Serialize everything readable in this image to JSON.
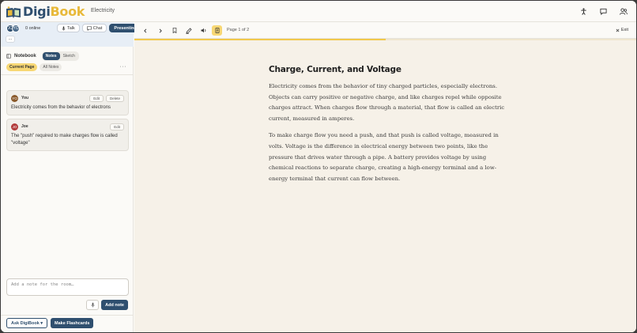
{
  "app": {
    "brand_part1": "Digi",
    "brand_part2": "Book",
    "page_topic": "Electricity"
  },
  "room": {
    "online_label": "0 online",
    "avatars": [
      "JO",
      "YO"
    ],
    "modes": [
      {
        "label": "Talk",
        "icon": "microphone-icon",
        "active": false
      },
      {
        "label": "Chat",
        "icon": "chat-icon",
        "active": false
      },
      {
        "label": "Presenting",
        "icon": "",
        "active": true
      }
    ],
    "more_label": "..."
  },
  "notebook": {
    "title": "Notebook",
    "tabs": [
      {
        "label": "Notes",
        "active": true
      },
      {
        "label": "Sketch",
        "active": false
      }
    ],
    "filters": [
      {
        "label": "Current Page",
        "active": true
      },
      {
        "label": "All Notes",
        "active": false
      }
    ],
    "menu_label": "···",
    "notes": [
      {
        "author": "You",
        "initials": "YO",
        "avatar_color": "#8a5a2b",
        "actions": [
          "Edit",
          "Delete"
        ],
        "text": "Electricity comes from the behavior of electrons"
      },
      {
        "author": "Joe",
        "initials": "JO",
        "avatar_color": "#b23a3a",
        "actions": [
          "Edit"
        ],
        "text": "The \"push\" required to make charges flow is called \"voltage\""
      }
    ],
    "input_placeholder": "Add a note for the room…",
    "add_label": "Add note"
  },
  "footer": {
    "ask_label": "Ask DigiBook ▾",
    "flashcards_label": "Make Flashcards"
  },
  "reader": {
    "page_label": "Page 1 of 2",
    "exit_label": "Exit",
    "progress": 0.5,
    "title": "Charge, Current, and Voltage",
    "paragraphs": [
      "Electricity comes from the behavior of tiny charged particles, especially electrons. Objects can carry positive or negative charge, and like charges repel while opposite charges attract. When charges flow through a material, that flow is called an electric current, measured in amperes.",
      "To make charge flow you need a push, and that push is called voltage, measured in volts. Voltage is the difference in electrical energy between two points, like the pressure that drives water through a pipe. A battery provides voltage by using chemical reactions to separate charge, creating a high-energy terminal and a low-energy terminal that current can flow between."
    ]
  },
  "colors": {
    "primary": "#2f4f6f",
    "accent": "#f7d774",
    "paper": "#f6f1e8"
  }
}
